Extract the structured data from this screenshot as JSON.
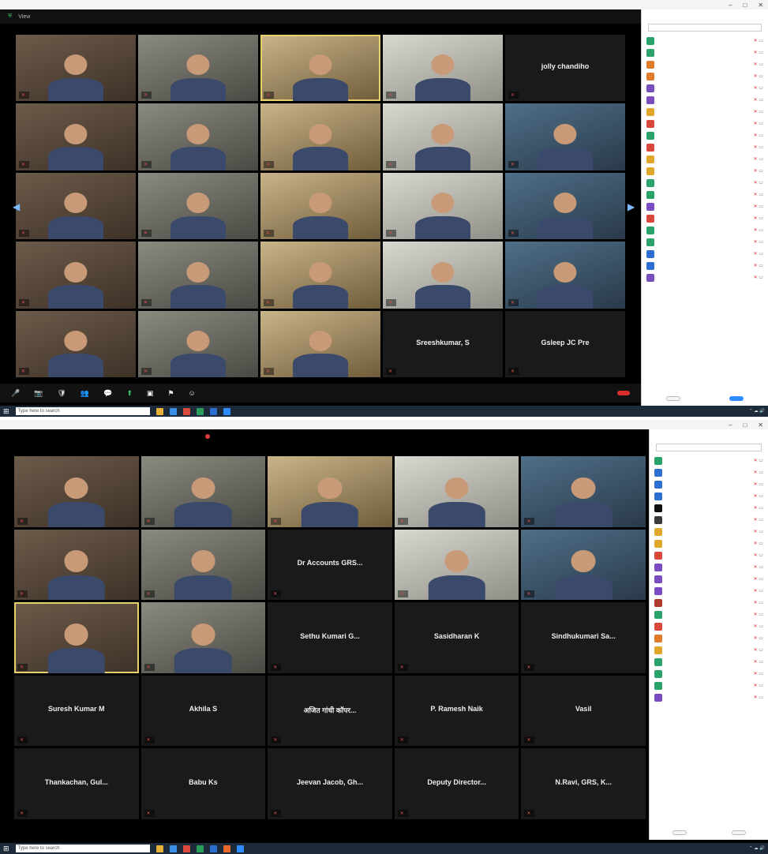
{
  "screen1": {
    "top": {
      "view": "View",
      "zoom": ""
    },
    "tiles": [
      {
        "label": "",
        "big": ""
      },
      {
        "label": "",
        "big": ""
      },
      {
        "label": "",
        "big": ""
      },
      {
        "label": "",
        "big": ""
      },
      {
        "label": "",
        "big": "jolly chandiho"
      },
      {
        "label": "",
        "big": ""
      },
      {
        "label": "",
        "big": ""
      },
      {
        "label": "",
        "big": ""
      },
      {
        "label": "",
        "big": ""
      },
      {
        "label": "",
        "big": ""
      },
      {
        "label": "",
        "big": ""
      },
      {
        "label": "",
        "big": ""
      },
      {
        "label": "",
        "big": ""
      },
      {
        "label": "",
        "big": ""
      },
      {
        "label": "",
        "big": ""
      },
      {
        "label": "",
        "big": ""
      },
      {
        "label": "",
        "big": ""
      },
      {
        "label": "",
        "big": ""
      },
      {
        "label": "",
        "big": ""
      },
      {
        "label": "",
        "big": ""
      },
      {
        "label": "",
        "big": ""
      },
      {
        "label": "",
        "big": ""
      },
      {
        "label": "",
        "big": ""
      },
      {
        "label": "",
        "big": "Sreeshkumar, S"
      },
      {
        "label": "",
        "big": "Gsleep JC Pre"
      }
    ],
    "toolbar": [
      {
        "g": "🎤",
        "label": ""
      },
      {
        "g": "📷",
        "label": ""
      },
      {
        "g": "🛡",
        "label": ""
      },
      {
        "g": "👥",
        "label": ""
      },
      {
        "g": "💬",
        "label": ""
      },
      {
        "g": "⬆",
        "label": "",
        "green": true
      },
      {
        "g": "▣",
        "label": ""
      },
      {
        "g": "⚑",
        "label": ""
      },
      {
        "g": "☺",
        "label": ""
      }
    ],
    "end": "",
    "taskbar_search": "Type here to search",
    "panel": {
      "title": "",
      "search": "",
      "participants": [
        {
          "name": "",
          "color": "#2aa36a"
        },
        {
          "name": "",
          "color": "#2aa36a"
        },
        {
          "name": "",
          "color": "#e07b2a"
        },
        {
          "name": "",
          "color": "#e07b2a"
        },
        {
          "name": "",
          "color": "#7a4cc2"
        },
        {
          "name": "",
          "color": "#7a4cc2"
        },
        {
          "name": "",
          "color": "#e0a82a"
        },
        {
          "name": "",
          "color": "#d9483b"
        },
        {
          "name": "",
          "color": "#2aa36a"
        },
        {
          "name": "",
          "color": "#d9483b"
        },
        {
          "name": "",
          "color": "#e0a82a"
        },
        {
          "name": "",
          "color": "#e0a82a"
        },
        {
          "name": "",
          "color": "#2aa36a"
        },
        {
          "name": "",
          "color": "#2aa36a"
        },
        {
          "name": "",
          "color": "#7a4cc2"
        },
        {
          "name": "",
          "color": "#d9483b"
        },
        {
          "name": "",
          "color": "#2aa36a"
        },
        {
          "name": "",
          "color": "#2aa36a"
        },
        {
          "name": "",
          "color": "#2d6fd0"
        },
        {
          "name": "",
          "color": "#2d6fd0"
        },
        {
          "name": "",
          "color": "#7a4cc2"
        }
      ],
      "invite": "",
      "mute_all": ""
    }
  },
  "screen2": {
    "top": {
      "rec": ""
    },
    "tiles": [
      {
        "label": "",
        "big": ""
      },
      {
        "label": "",
        "big": ""
      },
      {
        "label": "",
        "big": ""
      },
      {
        "label": "",
        "big": ""
      },
      {
        "label": "",
        "big": ""
      },
      {
        "label": "",
        "big": ""
      },
      {
        "label": "",
        "big": ""
      },
      {
        "label": "",
        "big": "Dr Accounts GRS..."
      },
      {
        "label": "",
        "big": ""
      },
      {
        "label": "",
        "big": ""
      },
      {
        "label": "",
        "big": ""
      },
      {
        "label": "",
        "big": ""
      },
      {
        "label": "",
        "big": "Sethu Kumari G..."
      },
      {
        "label": "",
        "big": "Sasidharan K"
      },
      {
        "label": "",
        "big": "Sindhukumari Sa..."
      },
      {
        "label": "",
        "big": "Suresh Kumar M"
      },
      {
        "label": "",
        "big": "Akhila S"
      },
      {
        "label": "",
        "big": "अजित गांधी कॉपर..."
      },
      {
        "label": "",
        "big": "P. Ramesh Naik"
      },
      {
        "label": "",
        "big": "Vasil"
      },
      {
        "label": "",
        "big": "Thankachan, Gul..."
      },
      {
        "label": "",
        "big": "Babu Ks"
      },
      {
        "label": "",
        "big": "Jeevan Jacob, Gh..."
      },
      {
        "label": "",
        "big": "Deputy Director..."
      },
      {
        "label": "",
        "big": "N.Ravi, GRS, K..."
      }
    ],
    "taskbar_search": "Type here to search",
    "panel": {
      "title": "",
      "search": "",
      "participants": [
        {
          "name": "",
          "color": "#2aa36a"
        },
        {
          "name": "",
          "color": "#2d6fd0"
        },
        {
          "name": "",
          "color": "#2d6fd0"
        },
        {
          "name": "",
          "color": "#2d6fd0"
        },
        {
          "name": "",
          "color": "#111111"
        },
        {
          "name": "",
          "color": "#3a3a3a"
        },
        {
          "name": "",
          "color": "#e0a82a"
        },
        {
          "name": "",
          "color": "#e0a82a"
        },
        {
          "name": "",
          "color": "#d9483b"
        },
        {
          "name": "",
          "color": "#7a4cc2"
        },
        {
          "name": "",
          "color": "#7a4cc2"
        },
        {
          "name": "",
          "color": "#7a4cc2"
        },
        {
          "name": "",
          "color": "#b03a2e"
        },
        {
          "name": "",
          "color": "#2aa36a"
        },
        {
          "name": "",
          "color": "#d9483b"
        },
        {
          "name": "",
          "color": "#e07b2a"
        },
        {
          "name": "",
          "color": "#e0a82a"
        },
        {
          "name": "",
          "color": "#2aa36a"
        },
        {
          "name": "",
          "color": "#2aa36a"
        },
        {
          "name": "",
          "color": "#2aa36a"
        },
        {
          "name": "",
          "color": "#7a4cc2"
        }
      ],
      "invite": "",
      "mute_all": ""
    }
  }
}
